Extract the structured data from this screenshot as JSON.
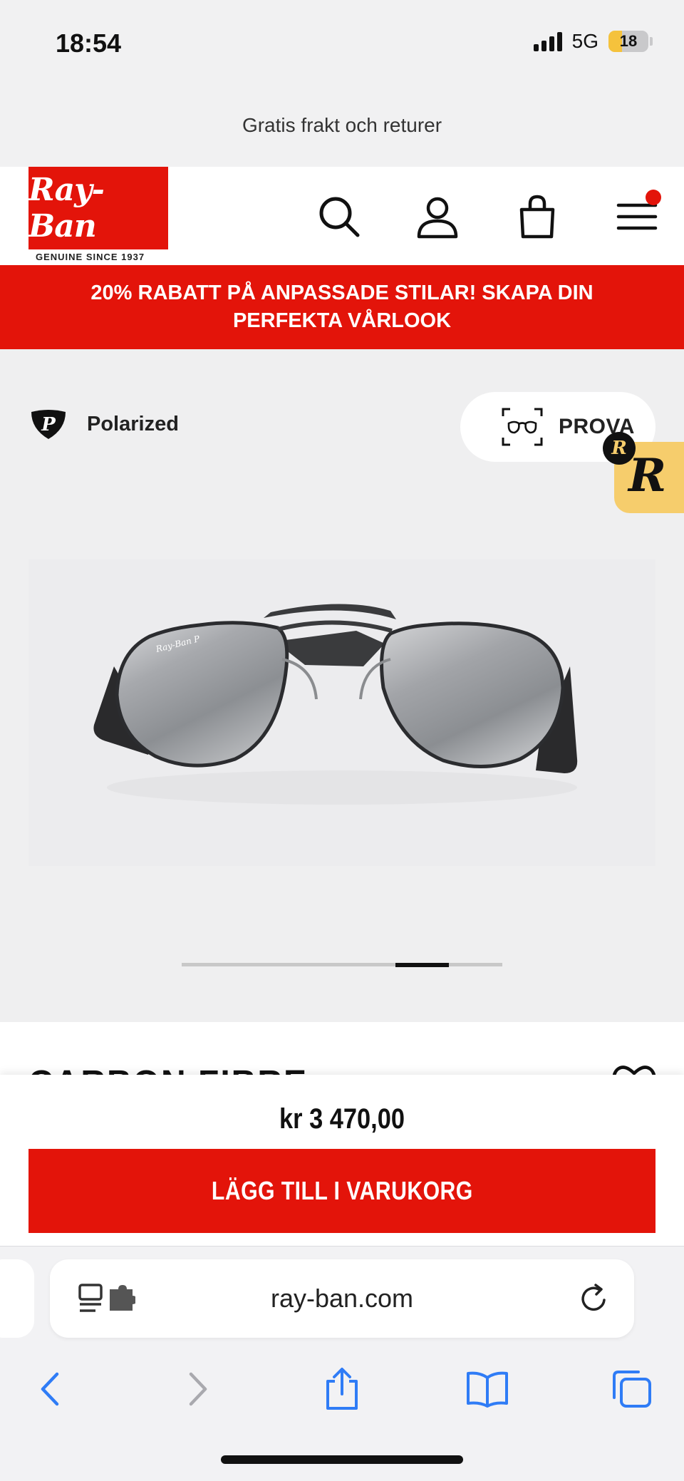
{
  "status_bar": {
    "time": "18:54",
    "network": "5G",
    "battery": "18"
  },
  "promo": {
    "text": "Gratis frakt och returer"
  },
  "header": {
    "logo_text": "Ray-Ban",
    "logo_tagline": "GENUINE SINCE 1937"
  },
  "banner": {
    "text": "20% RABATT PÅ ANPASSADE STILAR! SKAPA DIN PERFEKTA VÅRLOOK"
  },
  "gallery": {
    "badge_label": "Polarized",
    "try_on_label": "PROVA",
    "assistant_badge": "R",
    "lens_mark": "Ray-Ban P",
    "slide_count": 6,
    "active_slide": 5
  },
  "product": {
    "name": "CARBON FIBRE",
    "price": "kr 3 470,00",
    "add_to_cart": "LÄGG TILL I VARUKORG"
  },
  "browser": {
    "url": "ray-ban.com"
  },
  "colors": {
    "brand_red": "#e3140a",
    "assistant_yellow": "#f6cd6c",
    "browser_blue": "#2f7cf6"
  }
}
